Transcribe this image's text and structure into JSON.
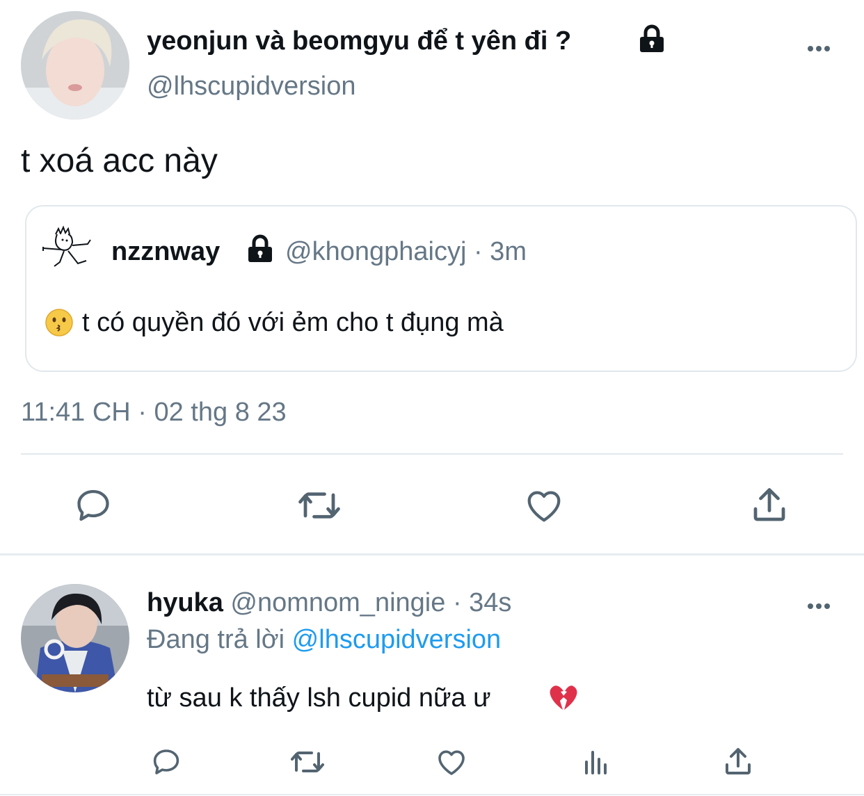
{
  "tweet": {
    "display_name": "yeonjun và beomgyu để t yên đi ?",
    "handle": "@lhscupidversion",
    "text": "t xoá acc này",
    "timestamp": "11:41 CH · 02 thg 8 23",
    "quote": {
      "display_name": "nzznway",
      "handle": "@khongphaicyj",
      "time": "· 3m",
      "text": "t có quyền đó với ẻm cho t đụng mà"
    }
  },
  "reply": {
    "display_name": "hyuka",
    "handle": "@nomnom_ningie",
    "time": "· 34s",
    "replying_label": "Đang trả lời",
    "replying_to": "@lhscupidversion",
    "text": "từ sau k thấy lsh cupid nữa ư"
  },
  "icons": [
    "lock-icon",
    "more-icon",
    "reply-icon",
    "retweet-icon",
    "like-icon",
    "share-icon",
    "analytics-icon",
    "kissing-face-emoji",
    "broken-heart-emoji"
  ],
  "colors": {
    "text": "#0f1419",
    "secondary": "#657786",
    "link": "#1d9bf0",
    "divider": "#e1e8ed"
  }
}
